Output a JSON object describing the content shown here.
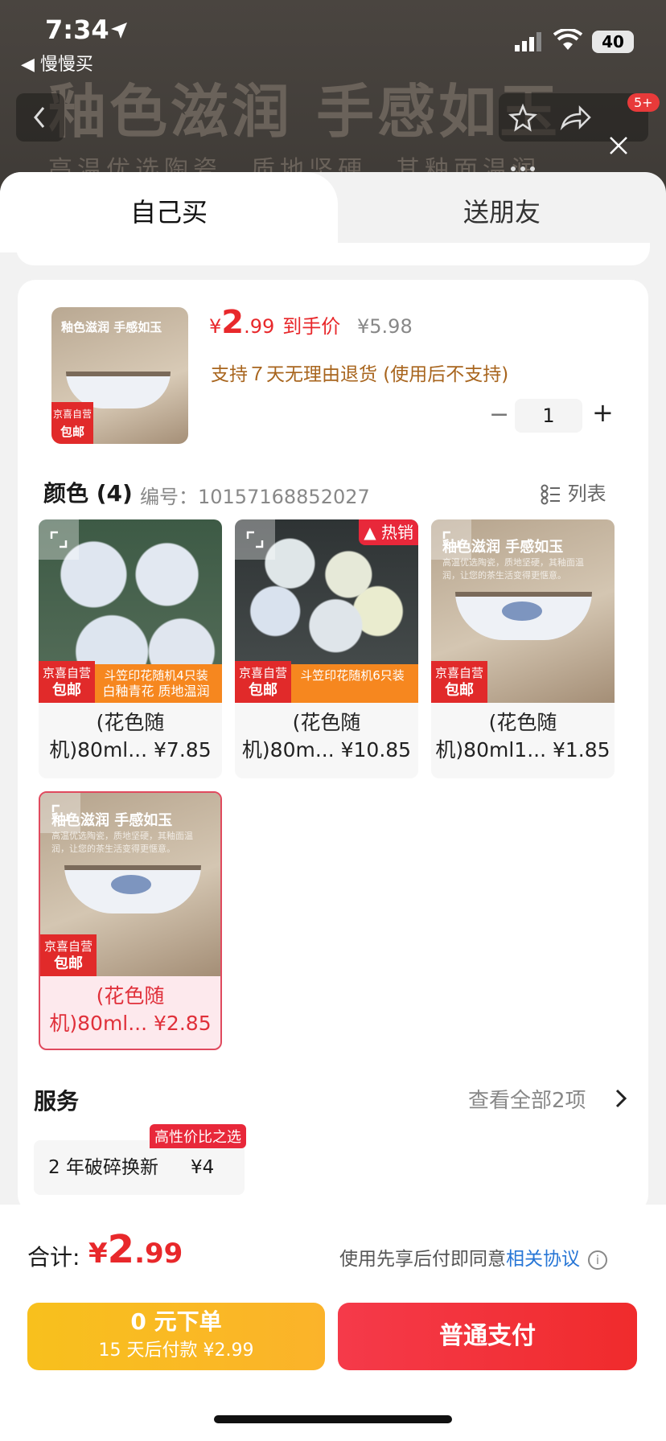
{
  "status": {
    "time": "7:34",
    "back_app": "◀ 慢慢买",
    "battery": "40"
  },
  "backdrop": {
    "title": "釉色滋润 手感如玉",
    "subtitle": "高温优选陶瓷，质地坚硬，其釉面温润",
    "badge": "5+"
  },
  "tabs": {
    "own": "自己买",
    "gift": "送朋友"
  },
  "product": {
    "thumb_title": "釉色滋润 手感如玉",
    "jd_label": "京喜自营",
    "jd_free": "包邮",
    "price_currency": "¥",
    "price_int": "2",
    "price_dec": ".99",
    "price_label": "到手价",
    "original_price": "¥5.98",
    "return_policy": "支持７天无理由退货 (使用后不支持)",
    "qty_minus": "−",
    "quantity": "1",
    "qty_plus": "+"
  },
  "colors": {
    "header": "颜色 (4)",
    "sku": "编号：10157168852027",
    "list_label": "列表",
    "options": [
      {
        "line1": "(花色随",
        "line2": "机)80ml... ¥7.85",
        "strip1": "斗笠印花随机4只装",
        "strip2": "白釉青花 质地温润"
      },
      {
        "line1": "(花色随",
        "line2": "机)80m... ¥10.85",
        "strip1": "斗笠印花随机6只装",
        "strip2": "",
        "hot": "热销"
      },
      {
        "line1": "(花色随",
        "line2": "机)80ml1... ¥1.85",
        "img_title": "釉色滋润 手感如玉",
        "img_sub": "高温优选陶瓷，质地坚硬，其釉面温润，让您的茶生活变得更惬意。"
      },
      {
        "line1": "(花色随",
        "line2": "机)80ml... ¥2.85",
        "img_title": "釉色滋润 手感如玉",
        "img_sub": "高温优选陶瓷，质地坚硬，其釉面温润，让您的茶生活变得更惬意。"
      }
    ]
  },
  "services": {
    "header": "服务",
    "view_all": "查看全部2项",
    "items": [
      {
        "label": "2 年破碎换新",
        "price": "¥4",
        "tag": "高性价比之选"
      }
    ]
  },
  "footer": {
    "total_label": "合计:",
    "total_currency": "¥",
    "total_int": "2",
    "total_dec": ".99",
    "agree_text": "使用先享后付即同意",
    "agree_link": "相关协议",
    "info": "i",
    "later_line1": "0 元下单",
    "later_line2": "15 天后付款 ¥2.99",
    "pay_label": "普通支付"
  }
}
